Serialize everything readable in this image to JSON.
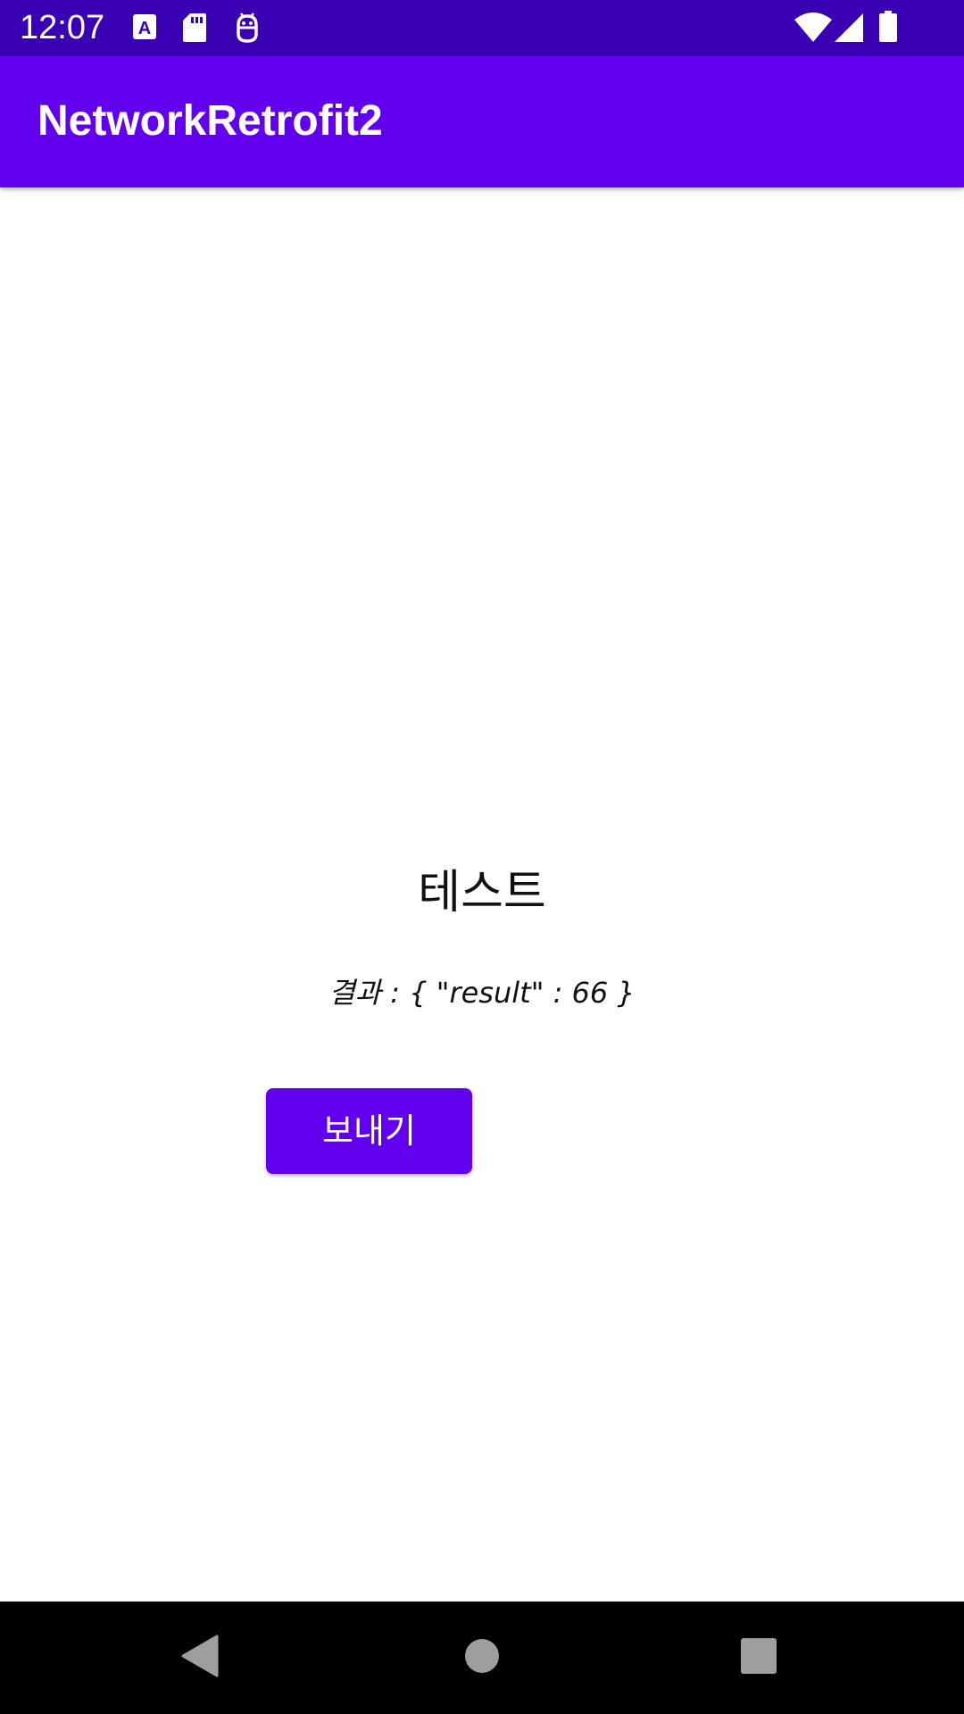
{
  "status_bar": {
    "time": "12:07",
    "icons": [
      "a-notification-icon",
      "sd-card-icon",
      "android-debug-icon",
      "wifi-icon",
      "cell-signal-icon",
      "battery-icon"
    ]
  },
  "app_bar": {
    "title": "NetworkRetrofit2"
  },
  "main": {
    "heading": "테스트",
    "result_text": "결과 : { \"result\" : 66 }",
    "send_button_label": "보내기"
  },
  "nav_bar": {
    "icons": [
      "back-icon",
      "home-icon",
      "recents-icon"
    ]
  },
  "colors": {
    "status_bar": "#3a00b3",
    "primary": "#6200ee",
    "nav_bar": "#000000"
  }
}
